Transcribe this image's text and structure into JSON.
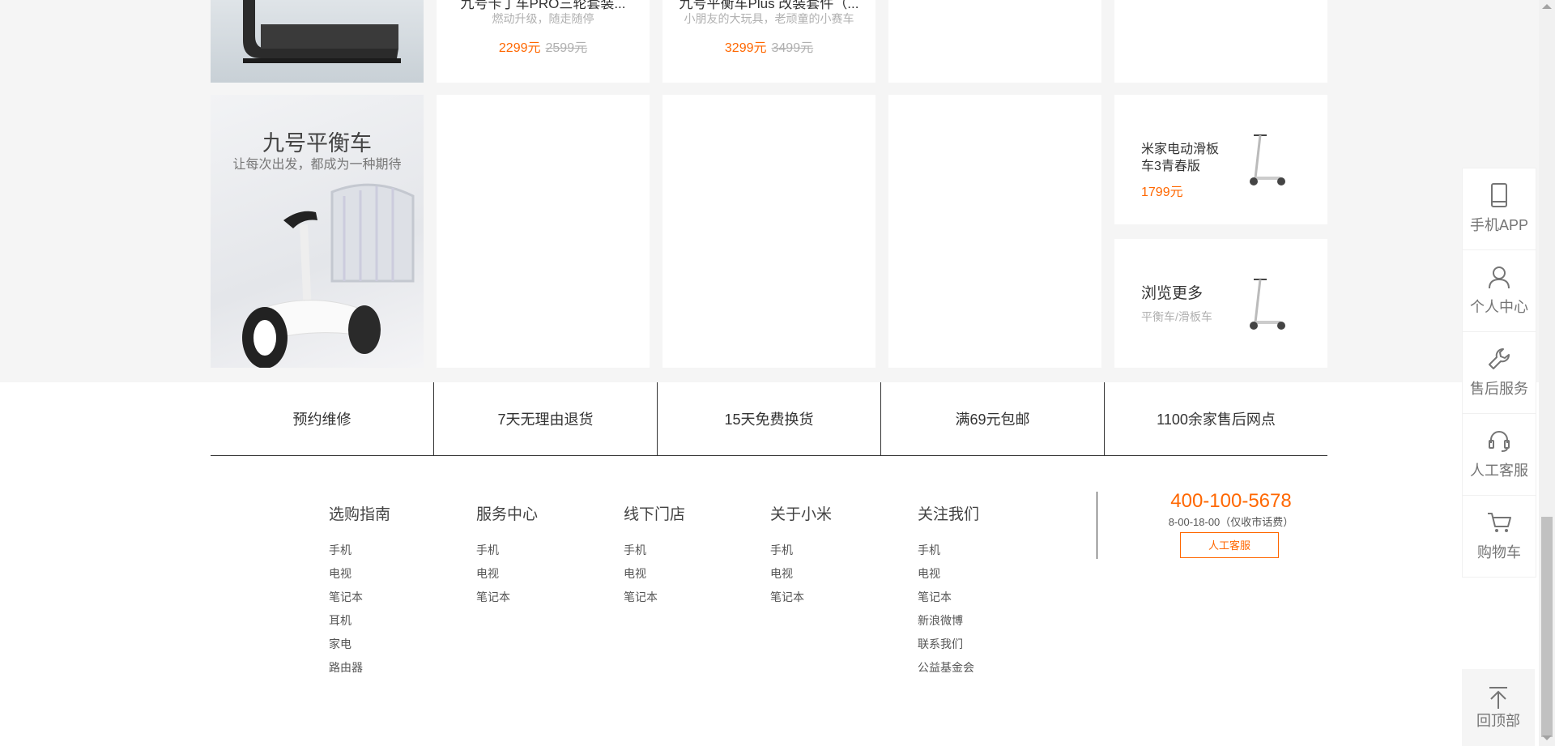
{
  "row1": {
    "products": [
      {
        "name": "九号卡丁车PRO三轮套装...",
        "desc": "燃动升级，随走随停",
        "price": "2299元",
        "old_price": "2599元"
      },
      {
        "name": "九号平衡车Plus 改装套件（...",
        "desc": "小朋友的大玩具，老顽童的小赛车",
        "price": "3299元",
        "old_price": "3499元"
      }
    ]
  },
  "promo": {
    "title": "九号平衡车",
    "subtitle": "让每次出发，都成为一种期待"
  },
  "side_cards": {
    "item": {
      "name_line1": "米家电动滑板",
      "name_line2": "车3青春版",
      "price": "1799元"
    },
    "more": {
      "title": "浏览更多",
      "sub": "平衡车/滑板车"
    }
  },
  "services": [
    "预约维修",
    "7天无理由退货",
    "15天免费换货",
    "满69元包邮",
    "1100余家售后网点"
  ],
  "footer": {
    "columns": [
      {
        "title": "选购指南",
        "links": [
          "手机",
          "电视",
          "笔记本",
          "耳机",
          "家电",
          "路由器"
        ]
      },
      {
        "title": "服务中心",
        "links": [
          "手机",
          "电视",
          "笔记本"
        ]
      },
      {
        "title": "线下门店",
        "links": [
          "手机",
          "电视",
          "笔记本"
        ]
      },
      {
        "title": "关于小米",
        "links": [
          "手机",
          "电视",
          "笔记本"
        ]
      },
      {
        "title": "关注我们",
        "links": [
          "手机",
          "电视",
          "笔记本",
          "新浪微博",
          "联系我们",
          "公益基金会"
        ]
      }
    ],
    "contact": {
      "phone": "400-100-5678",
      "hours": "8-00-18-00（仅收市话费）",
      "button": "人工客服"
    }
  },
  "sidebar": {
    "items": [
      {
        "icon": "phone-icon",
        "label": "手机APP"
      },
      {
        "icon": "user-icon",
        "label": "个人中心"
      },
      {
        "icon": "wrench-icon",
        "label": "售后服务"
      },
      {
        "icon": "headset-icon",
        "label": "人工客服"
      },
      {
        "icon": "cart-icon",
        "label": "购物车"
      }
    ],
    "back_to_top": "回顶部"
  },
  "colors": {
    "accent": "#ff6700",
    "bg": "#f5f5f5"
  }
}
